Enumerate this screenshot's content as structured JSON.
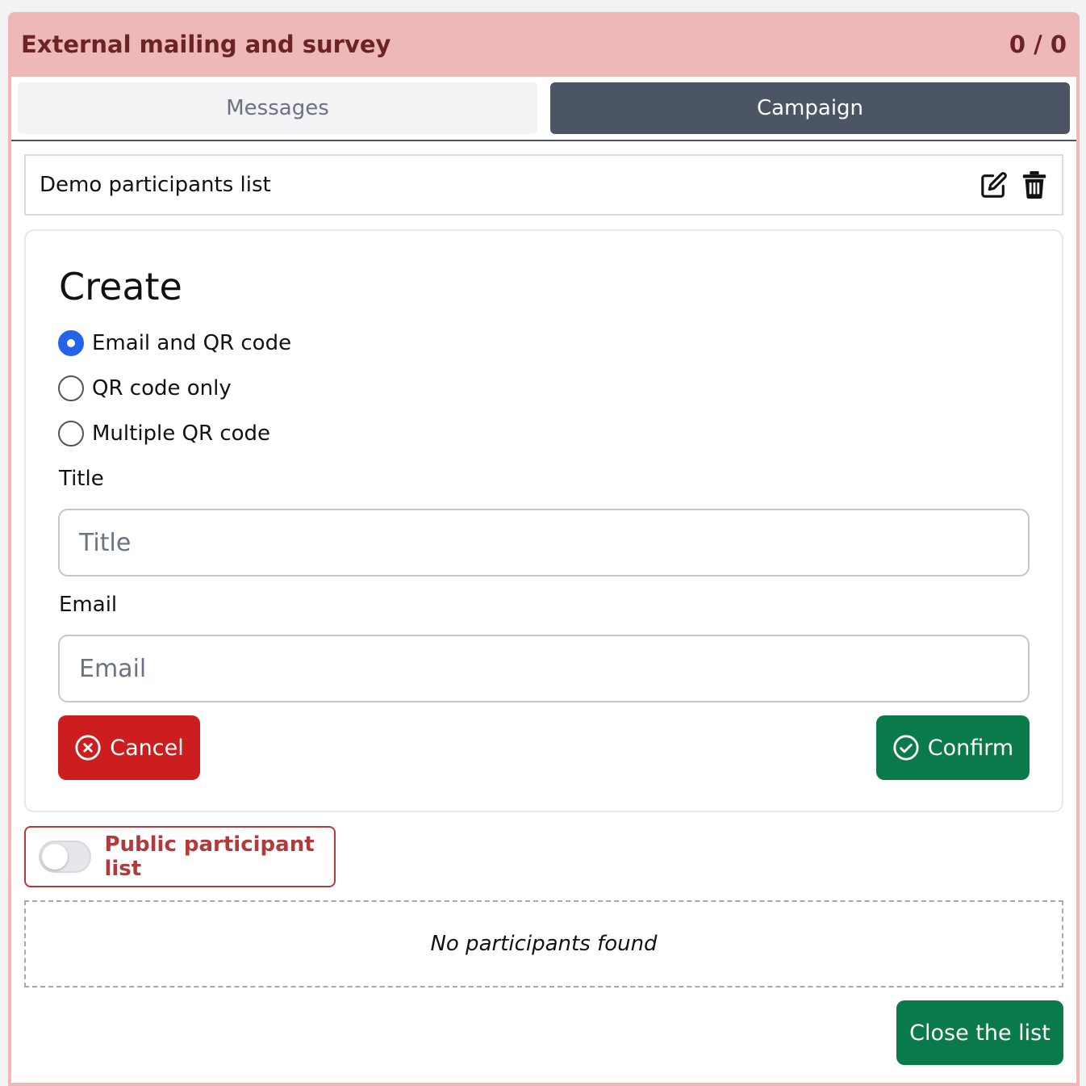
{
  "header": {
    "title": "External mailing and survey",
    "count": "0 / 0"
  },
  "tabs": [
    {
      "label": "Messages",
      "active": false
    },
    {
      "label": "Campaign",
      "active": true
    }
  ],
  "list": {
    "name": "Demo participants list",
    "edit_icon": "edit-icon",
    "delete_icon": "trash-icon"
  },
  "create": {
    "title": "Create",
    "options": [
      {
        "label": "Email and QR code",
        "selected": true
      },
      {
        "label": "QR code only",
        "selected": false
      },
      {
        "label": "Multiple QR code",
        "selected": false
      }
    ],
    "title_field": {
      "label": "Title",
      "placeholder": "Title",
      "value": ""
    },
    "email_field": {
      "label": "Email",
      "placeholder": "Email",
      "value": ""
    },
    "cancel_label": "Cancel",
    "confirm_label": "Confirm"
  },
  "public_toggle": {
    "label": "Public participant list",
    "on": false
  },
  "empty_message": "No participants found",
  "close_label": "Close the list",
  "colors": {
    "header_bg": "#efb8b8",
    "active_tab": "#4b5563",
    "danger": "#cc1e1e",
    "success": "#0b7a4b",
    "radio_accent": "#2563eb"
  }
}
